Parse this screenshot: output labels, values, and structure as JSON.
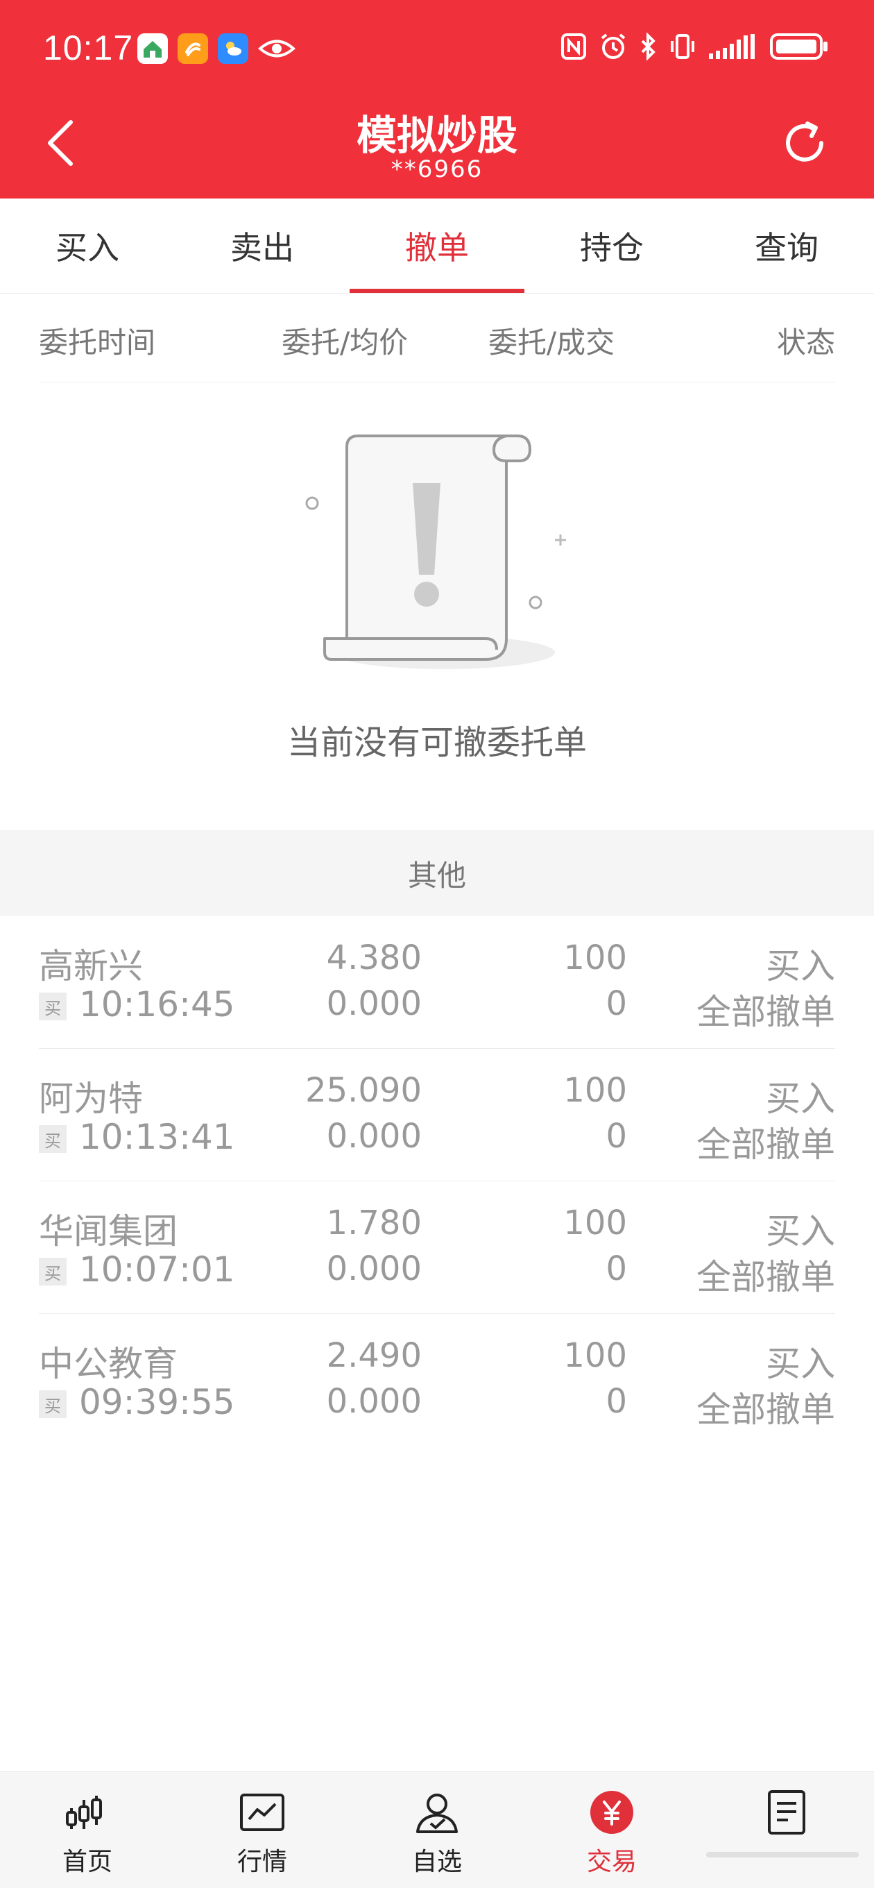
{
  "status_bar": {
    "time": "10:17",
    "left_icons": [
      "home-app-icon",
      "orange-app-icon",
      "weather-app-icon",
      "eye-icon"
    ],
    "right_icons": [
      "nfc-icon",
      "alarm-icon",
      "bluetooth-icon",
      "vibrate-icon",
      "signal-icon",
      "battery-icon"
    ]
  },
  "header": {
    "title": "模拟炒股",
    "account": "**6966"
  },
  "tabs": [
    {
      "label": "买入",
      "active": false
    },
    {
      "label": "卖出",
      "active": false
    },
    {
      "label": "撤单",
      "active": true
    },
    {
      "label": "持仓",
      "active": false
    },
    {
      "label": "查询",
      "active": false
    }
  ],
  "columns": {
    "time": "委托时间",
    "price": "委托/均价",
    "qty": "委托/成交",
    "status": "状态"
  },
  "empty_state": {
    "message": "当前没有可撤委托单"
  },
  "other_section": {
    "title": "其他"
  },
  "orders": [
    {
      "name": "高新兴",
      "badge": "买",
      "time": "10:16:45",
      "price": "4.380",
      "avg": "0.000",
      "qty": "100",
      "filled": "0",
      "side": "买入",
      "status": "全部撤单"
    },
    {
      "name": "阿为特",
      "badge": "买",
      "time": "10:13:41",
      "price": "25.090",
      "avg": "0.000",
      "qty": "100",
      "filled": "0",
      "side": "买入",
      "status": "全部撤单"
    },
    {
      "name": "华闻集团",
      "badge": "买",
      "time": "10:07:01",
      "price": "1.780",
      "avg": "0.000",
      "qty": "100",
      "filled": "0",
      "side": "买入",
      "status": "全部撤单"
    },
    {
      "name": "中公教育",
      "badge": "买",
      "time": "09:39:55",
      "price": "2.490",
      "avg": "0.000",
      "qty": "100",
      "filled": "0",
      "side": "买入",
      "status": "全部撤单"
    }
  ],
  "bottom_nav": [
    {
      "label": "首页",
      "icon": "candlestick-icon",
      "active": false
    },
    {
      "label": "行情",
      "icon": "chart-icon",
      "active": false
    },
    {
      "label": "自选",
      "icon": "user-check-icon",
      "active": false
    },
    {
      "label": "交易",
      "icon": "yen-icon",
      "active": true
    },
    {
      "label": "",
      "icon": "document-icon",
      "active": false
    }
  ],
  "colors": {
    "brand_red": "#f0303a",
    "active_red": "#e0303a",
    "muted_text": "#999999"
  }
}
